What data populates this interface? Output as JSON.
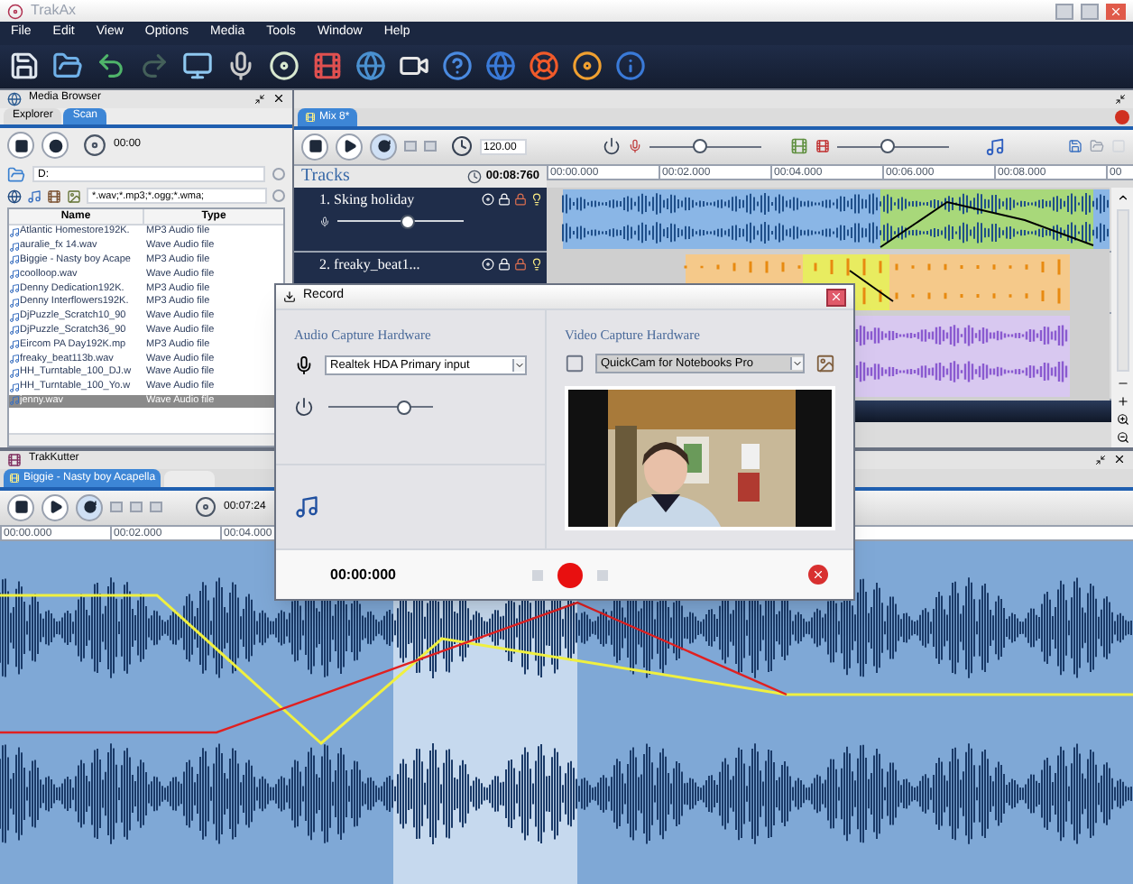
{
  "window": {
    "title": "TrakAx"
  },
  "menu": [
    "File",
    "Edit",
    "View",
    "Options",
    "Media",
    "Tools",
    "Window",
    "Help"
  ],
  "media_browser": {
    "title": "Media Browser",
    "tabs": [
      {
        "label": "Explorer",
        "selected": false
      },
      {
        "label": "Scan",
        "selected": true
      }
    ],
    "time": "00:00",
    "path": "D:",
    "filter": "*.wav;*.mp3;*.ogg;*.wma;",
    "columns": [
      "Name",
      "Type"
    ],
    "files": [
      {
        "name": "Atlantic Homestore192K.",
        "type": "MP3 Audio file",
        "selected": false
      },
      {
        "name": "auralie_fx 14.wav",
        "type": "Wave Audio file",
        "selected": false
      },
      {
        "name": "Biggie - Nasty boy Acape",
        "type": "MP3 Audio file",
        "selected": false
      },
      {
        "name": "coolloop.wav",
        "type": "Wave Audio file",
        "selected": false
      },
      {
        "name": "Denny Dedication192K.",
        "type": "MP3 Audio file",
        "selected": false
      },
      {
        "name": "Denny Interflowers192K.",
        "type": "MP3 Audio file",
        "selected": false
      },
      {
        "name": "DjPuzzle_Scratch10_90",
        "type": "Wave Audio file",
        "selected": false
      },
      {
        "name": "DjPuzzle_Scratch36_90",
        "type": "Wave Audio file",
        "selected": false
      },
      {
        "name": "Eircom PA Day192K.mp",
        "type": "MP3 Audio file",
        "selected": false
      },
      {
        "name": "freaky_beat113b.wav",
        "type": "Wave Audio file",
        "selected": false
      },
      {
        "name": "HH_Turntable_100_DJ.w",
        "type": "Wave Audio file",
        "selected": false
      },
      {
        "name": "HH_Turntable_100_Yo.w",
        "type": "Wave Audio file",
        "selected": false
      },
      {
        "name": "jenny.wav",
        "type": "Wave Audio file",
        "selected": true
      }
    ]
  },
  "mix": {
    "tabs": [
      {
        "label": "Mix 8*",
        "selected": true
      }
    ],
    "tempo": "120.00",
    "volume": {
      "level": 0.45
    },
    "effect": {
      "level": 0.45
    },
    "tracks_title": "Tracks",
    "position": "00:08:760",
    "ruler": [
      "00:00.000",
      "00:02.000",
      "00:04.000",
      "00:06.000",
      "00:08.000",
      "00"
    ],
    "tracks": [
      {
        "name": "1. Sking holiday",
        "level": 0.55
      },
      {
        "name": "2. freaky_beat1..."
      }
    ]
  },
  "trakkutter": {
    "title": "TrakKutter",
    "tabs": [
      {
        "label": "Biggie - Nasty boy Acapella",
        "selected": true
      }
    ],
    "time": "00:07:24",
    "ruler": [
      "00:00.000",
      "00:02.000",
      "00:04.000"
    ]
  },
  "record_dialog": {
    "title": "Record",
    "audio_heading": "Audio Capture Hardware",
    "audio_device": "Realtek HDA Primary input",
    "level": 0.72,
    "video_heading": "Video Capture Hardware",
    "video_device": "QuickCam for Notebooks Pro",
    "time": "00:00:000"
  }
}
